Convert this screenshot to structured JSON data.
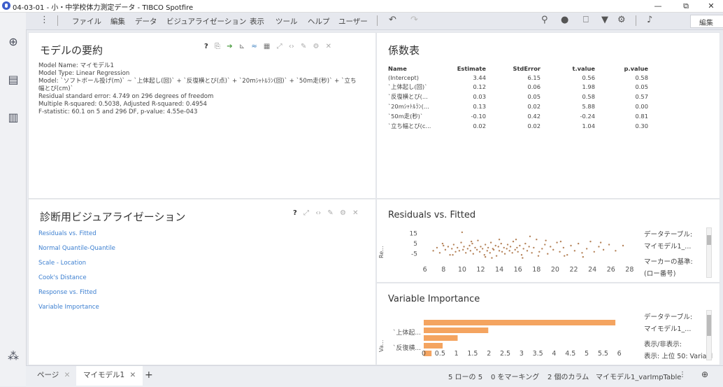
{
  "window": {
    "title": "04-03-01 - 小・中学校体力測定データ - TIBCO Spotfire",
    "minimize": "—",
    "restore": "⧉",
    "close": "✕"
  },
  "menubar": {
    "items": [
      "ファイル",
      "編集",
      "データ",
      "ビジュアライゼーション",
      "表示",
      "ツール",
      "ヘルプ",
      "ユーザー"
    ],
    "mode_select": "編集"
  },
  "model_summary": {
    "title": "モデルの要約",
    "lines": [
      "Model Name: マイモデル1",
      "Model Type: Linear Regression",
      "Model: `ソフトボール投げ(m)` ~ `上体起し(回)` + `反復横とび(点)` + `20mｼｬﾄﾙﾗﾝ(回)` + `50m走(秒)` + `立ち幅とび(cm)`",
      "Residual standard error: 4.749 on 296 degrees of freedom",
      "Multiple R-squared: 0.5038, Adjusted R-squared: 0.4954",
      "F-statistic: 60.1 on 5 and 296 DF, p-value: 4.55e-043"
    ]
  },
  "coef_table": {
    "title": "係数表",
    "columns": [
      "Name",
      "Estimate",
      "StdError",
      "t.value",
      "p.value"
    ],
    "rows": [
      [
        "(Intercept)",
        "3.44",
        "6.15",
        "0.56",
        "0.58"
      ],
      [
        "`上体起し(回)`",
        "0.12",
        "0.06",
        "1.98",
        "0.05"
      ],
      [
        "`反復横とび(...",
        "0.03",
        "0.05",
        "0.58",
        "0.57"
      ],
      [
        "`20mｼｬﾄﾙﾗﾝ(...",
        "0.13",
        "0.02",
        "5.88",
        "0.00"
      ],
      [
        "`50m走(秒)`",
        "-0.10",
        "0.42",
        "-0.24",
        "0.81"
      ],
      [
        "`立ち幅とび(c...",
        "0.02",
        "0.02",
        "1.04",
        "0.30"
      ]
    ]
  },
  "diagnostics": {
    "title": "診断用ビジュアライゼーション",
    "links": [
      "Residuals vs. Fitted",
      "Normal Quantile-Quantile",
      "Scale - Location",
      "Cook's Distance",
      "Response vs. Fitted",
      "Variable Importance"
    ]
  },
  "residuals_chart": {
    "title": "Residuals vs. Fitted",
    "legend": [
      "データテーブル:",
      "マイモデル1_...",
      "マーカーの基準:",
      "(ロー番号)"
    ]
  },
  "varimp_chart": {
    "title": "Variable Importance",
    "legend": [
      "データテーブル:",
      "マイモデル1_...",
      "表示/非表示:",
      "表示: 上位 50: Variabl"
    ]
  },
  "chart_data": [
    {
      "type": "scatter",
      "title": "Residuals vs. Fitted",
      "xlabel": "",
      "ylabel": "Re...",
      "xlim": [
        5.5,
        28.5
      ],
      "ylim": [
        -12,
        18
      ],
      "xticks": [
        6,
        8,
        10,
        12,
        14,
        16,
        18,
        20,
        22,
        24,
        26,
        28
      ],
      "yticks": [
        15,
        5,
        -5
      ],
      "color": "#b5835a",
      "points": [
        [
          6.9,
          -2
        ],
        [
          7.3,
          1
        ],
        [
          7.6,
          -4
        ],
        [
          8.0,
          3
        ],
        [
          8.2,
          -1
        ],
        [
          8.5,
          2
        ],
        [
          8.7,
          -6
        ],
        [
          8.9,
          0
        ],
        [
          9.1,
          4
        ],
        [
          9.3,
          -3
        ],
        [
          9.5,
          1
        ],
        [
          9.7,
          -2
        ],
        [
          9.9,
          6
        ],
        [
          10.1,
          -1
        ],
        [
          10.2,
          2
        ],
        [
          10.4,
          -4
        ],
        [
          10.6,
          0
        ],
        [
          10.8,
          3
        ],
        [
          10.9,
          -2
        ],
        [
          11.1,
          5
        ],
        [
          11.2,
          -5
        ],
        [
          11.4,
          1
        ],
        [
          11.6,
          -1
        ],
        [
          11.7,
          8
        ],
        [
          11.9,
          -3
        ],
        [
          12.0,
          2
        ],
        [
          12.2,
          0
        ],
        [
          12.4,
          -6
        ],
        [
          12.5,
          4
        ],
        [
          12.7,
          -2
        ],
        [
          12.8,
          1
        ],
        [
          13.0,
          -4
        ],
        [
          13.1,
          6
        ],
        [
          13.3,
          0
        ],
        [
          13.4,
          -1
        ],
        [
          13.6,
          3
        ],
        [
          13.7,
          -7
        ],
        [
          13.9,
          2
        ],
        [
          14.0,
          -2
        ],
        [
          14.2,
          5
        ],
        [
          14.3,
          -3
        ],
        [
          14.5,
          1
        ],
        [
          14.6,
          -5
        ],
        [
          14.8,
          0
        ],
        [
          14.9,
          4
        ],
        [
          15.1,
          -2
        ],
        [
          15.2,
          2
        ],
        [
          15.4,
          -4
        ],
        [
          15.5,
          7
        ],
        [
          15.7,
          -1
        ],
        [
          15.9,
          1
        ],
        [
          16.0,
          -3
        ],
        [
          16.2,
          3
        ],
        [
          16.4,
          -6
        ],
        [
          16.6,
          0
        ],
        [
          16.8,
          5
        ],
        [
          17.0,
          -2
        ],
        [
          17.2,
          2
        ],
        [
          17.5,
          -4
        ],
        [
          17.7,
          1
        ],
        [
          18.0,
          9
        ],
        [
          18.3,
          -3
        ],
        [
          18.6,
          0
        ],
        [
          18.9,
          4
        ],
        [
          19.2,
          -5
        ],
        [
          19.5,
          2
        ],
        [
          19.8,
          -1
        ],
        [
          20.2,
          6
        ],
        [
          20.5,
          -3
        ],
        [
          20.9,
          1
        ],
        [
          21.3,
          -6
        ],
        [
          21.7,
          3
        ],
        [
          22.1,
          -2
        ],
        [
          22.5,
          5
        ],
        [
          22.9,
          -4
        ],
        [
          23.4,
          0
        ],
        [
          23.8,
          7
        ],
        [
          24.2,
          -3
        ],
        [
          24.7,
          2
        ],
        [
          25.2,
          -1
        ],
        [
          25.8,
          4
        ],
        [
          26.5,
          -2
        ],
        [
          27.3,
          3
        ],
        [
          10.0,
          16
        ],
        [
          12.5,
          -8
        ],
        [
          14.0,
          9
        ],
        [
          16.5,
          -9
        ],
        [
          19.0,
          8
        ],
        [
          21.0,
          -7
        ],
        [
          9.0,
          -6
        ],
        [
          11.0,
          7
        ],
        [
          13.2,
          -9
        ],
        [
          15.8,
          9
        ],
        [
          18.2,
          -7
        ],
        [
          20.6,
          7
        ],
        [
          23.0,
          -8
        ],
        [
          7.9,
          5
        ],
        [
          17.3,
          12
        ],
        [
          24.9,
          6
        ]
      ]
    },
    {
      "type": "bar",
      "orientation": "horizontal",
      "title": "Variable Importance",
      "xlabel": "",
      "ylabel": "Va...",
      "xlim": [
        0,
        6.2
      ],
      "xticks": [
        0,
        0.5,
        1,
        1.5,
        2,
        2.5,
        3,
        3.5,
        4,
        4.5,
        5,
        5.5,
        6
      ],
      "categories": [
        "",
        "`上体起...",
        "",
        "`反復横...",
        ""
      ],
      "values": [
        5.88,
        1.98,
        1.04,
        0.58,
        0.24
      ],
      "color": "#f4a460"
    }
  ],
  "status": {
    "tabs": [
      "ページ",
      "マイモデル1"
    ],
    "add_tab": "+",
    "rows": "5 ローの 5",
    "marking": "0 をマーキング",
    "columns": "2 個のカラム",
    "table": "マイモデル1_varImpTable",
    "more": "⋮"
  }
}
